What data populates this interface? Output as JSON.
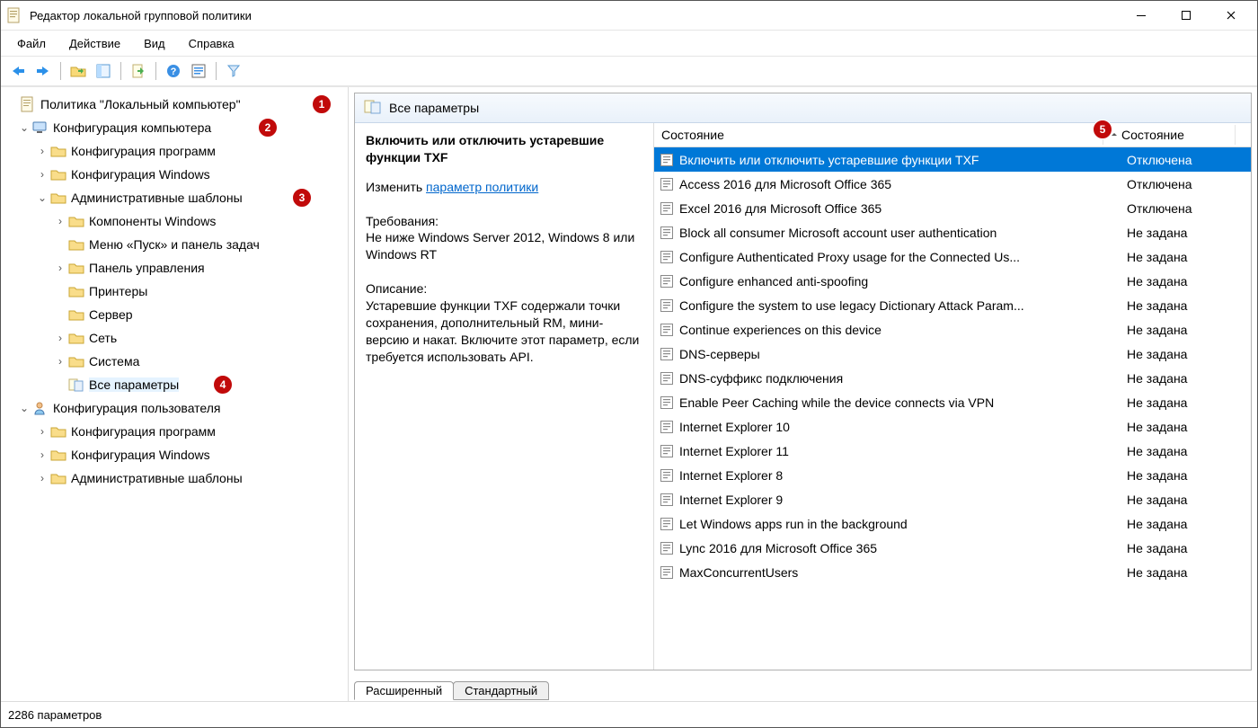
{
  "window": {
    "title": "Редактор локальной групповой политики"
  },
  "menubar": [
    "Файл",
    "Действие",
    "Вид",
    "Справка"
  ],
  "tree": {
    "root": "Политика \"Локальный компьютер\"",
    "cc": "Конфигурация компьютера",
    "cc_soft": "Конфигурация программ",
    "cc_win": "Конфигурация Windows",
    "cc_adm": "Административные шаблоны",
    "adm_comp": "Компоненты Windows",
    "adm_start": "Меню «Пуск» и панель задач",
    "adm_cpl": "Панель управления",
    "adm_print": "Принтеры",
    "adm_server": "Сервер",
    "adm_net": "Сеть",
    "adm_sys": "Система",
    "adm_all": "Все параметры",
    "uc": "Конфигурация пользователя",
    "uc_soft": "Конфигурация программ",
    "uc_win": "Конфигурация Windows",
    "uc_adm": "Административные шаблоны"
  },
  "panel": {
    "title": "Все параметры",
    "desc_title": "Включить или отключить устаревшие функции TXF",
    "edit_prefix": "Изменить ",
    "edit_link": "параметр политики",
    "req_label": "Требования:",
    "req_text": "Не ниже Windows Server 2012, Windows 8 или Windows RT",
    "desc_label": "Описание:",
    "desc_text": "Устаревшие функции TXF содержали точки сохранения, дополнительный RM, мини-версию и накат. Включите этот параметр, если требуется использовать API."
  },
  "columns": {
    "name": "Состояние",
    "state": "Состояние"
  },
  "rows": [
    {
      "name": "Включить или отключить устаревшие функции TXF",
      "state": "Отключена",
      "sel": true
    },
    {
      "name": "Access 2016 для Microsoft Office 365",
      "state": "Отключена"
    },
    {
      "name": "Excel 2016 для Microsoft Office 365",
      "state": "Отключена"
    },
    {
      "name": "Block all consumer Microsoft account user authentication",
      "state": "Не задана"
    },
    {
      "name": "Configure Authenticated Proxy usage for the Connected Us...",
      "state": "Не задана"
    },
    {
      "name": "Configure enhanced anti-spoofing",
      "state": "Не задана"
    },
    {
      "name": "Configure the system to use legacy Dictionary Attack Param...",
      "state": "Не задана"
    },
    {
      "name": "Continue experiences on this device",
      "state": "Не задана"
    },
    {
      "name": "DNS-серверы",
      "state": "Не задана"
    },
    {
      "name": "DNS-суффикс подключения",
      "state": "Не задана"
    },
    {
      "name": "Enable Peer Caching while the device connects via VPN",
      "state": "Не задана"
    },
    {
      "name": "Internet Explorer 10",
      "state": "Не задана"
    },
    {
      "name": "Internet Explorer 11",
      "state": "Не задана"
    },
    {
      "name": "Internet Explorer 8",
      "state": "Не задана"
    },
    {
      "name": "Internet Explorer 9",
      "state": "Не задана"
    },
    {
      "name": "Let Windows apps run in the background",
      "state": "Не задана"
    },
    {
      "name": "Lync 2016 для Microsoft Office 365",
      "state": "Не задана"
    },
    {
      "name": "MaxConcurrentUsers",
      "state": "Не задана"
    }
  ],
  "tabs": {
    "ext": "Расширенный",
    "std": "Стандартный"
  },
  "status": "2286 параметров"
}
